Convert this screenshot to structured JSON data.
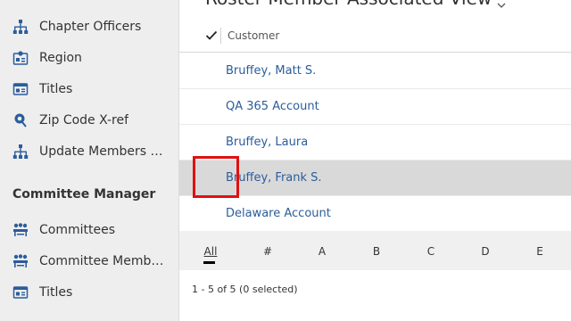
{
  "sidebar": {
    "top_partial": "",
    "items": [
      {
        "label": "Chapter Officers",
        "icon": "org-chart-icon"
      },
      {
        "label": "Region",
        "icon": "map-card-icon"
      },
      {
        "label": "Titles",
        "icon": "id-card-icon"
      },
      {
        "label": "Zip Code X-ref",
        "icon": "location-pin-icon"
      },
      {
        "label": "Update Members Ch...",
        "icon": "org-chart-icon"
      }
    ],
    "section_title": "Committee Manager",
    "committee_items": [
      {
        "label": "Committees",
        "icon": "group-icon"
      },
      {
        "label": "Committee Members",
        "icon": "group-icon"
      },
      {
        "label": "Titles",
        "icon": "id-card-icon"
      }
    ]
  },
  "main": {
    "view_title": "Roster Member Associated View",
    "column_header": "Customer",
    "rows": [
      {
        "name": "Bruffey, Matt S.",
        "selected": false
      },
      {
        "name": "QA 365 Account",
        "selected": false
      },
      {
        "name": "Bruffey, Laura",
        "selected": false
      },
      {
        "name": "Bruffey, Frank S.",
        "selected": true
      },
      {
        "name": "Delaware Account",
        "selected": false
      }
    ],
    "jump_letters": [
      "All",
      "#",
      "A",
      "B",
      "C",
      "D",
      "E"
    ],
    "record_count": "1 - 5 of 5 (0 selected)"
  },
  "colors": {
    "link": "#2b5d9c",
    "sidebar_bg": "#eeeeee",
    "icon_blue": "#2b5d9c",
    "selected_row": "#d9d9d9",
    "highlight_box": "#e01010"
  }
}
